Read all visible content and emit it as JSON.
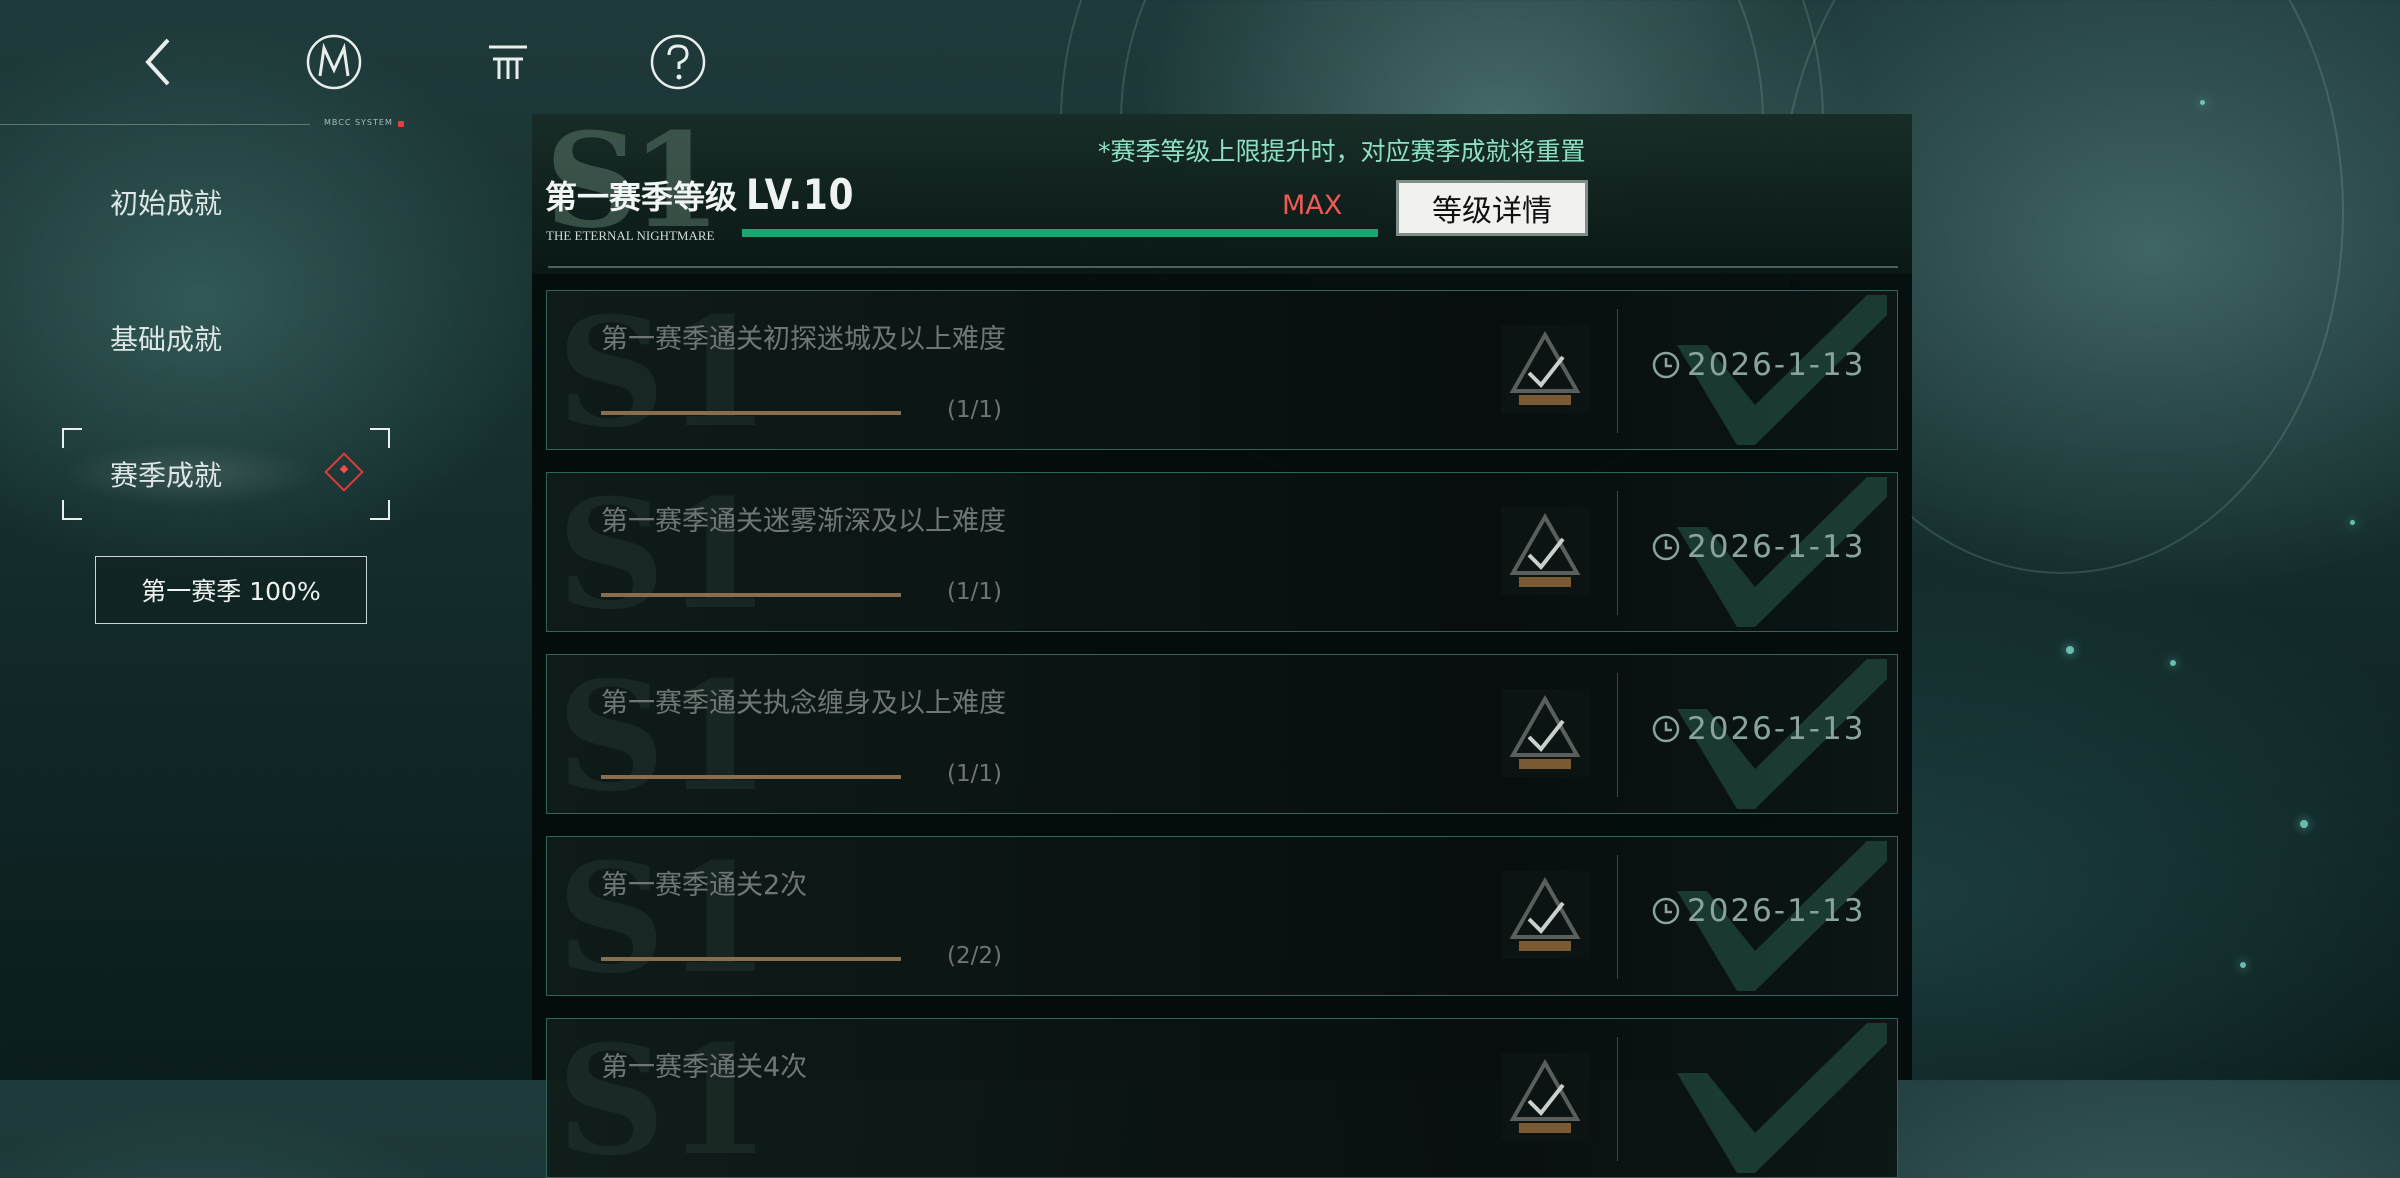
{
  "toolbar": {
    "system_mark": "MBCC SYSTEM"
  },
  "sidebar": {
    "items": [
      {
        "label": "初始成就"
      },
      {
        "label": "基础成就"
      },
      {
        "label": "赛季成就"
      }
    ],
    "season_button": "第一赛季 100%"
  },
  "header": {
    "notice": "*赛季等级上限提升时，对应赛季成就将重置",
    "season_title": "第一赛季等级",
    "season_subtitle": "THE ETERNAL NIGHTMARE",
    "level": "LV.10",
    "level_progress": 1.0,
    "max_label": "MAX",
    "detail_button": "等级详情"
  },
  "achievements": [
    {
      "title": "第一赛季通关初探迷城及以上难度",
      "progress": "(1/1)",
      "date": "2026-1-13"
    },
    {
      "title": "第一赛季通关迷雾渐深及以上难度",
      "progress": "(1/1)",
      "date": "2026-1-13"
    },
    {
      "title": "第一赛季通关执念缠身及以上难度",
      "progress": "(1/1)",
      "date": "2026-1-13"
    },
    {
      "title": "第一赛季通关2次",
      "progress": "(2/2)",
      "date": "2026-1-13"
    },
    {
      "title": "第一赛季通关4次",
      "progress": "",
      "date": ""
    }
  ],
  "colors": {
    "accent_green": "#1fa371",
    "notice_text": "#8ee0c4",
    "max_red": "#ef5a53",
    "active_diamond": "#e03a3a"
  },
  "icons": [
    "back-arrow-icon",
    "m-logo-icon",
    "menu-icon",
    "help-icon",
    "clock-icon",
    "trophy-icon",
    "checkmark-icon",
    "notification-diamond-icon"
  ]
}
